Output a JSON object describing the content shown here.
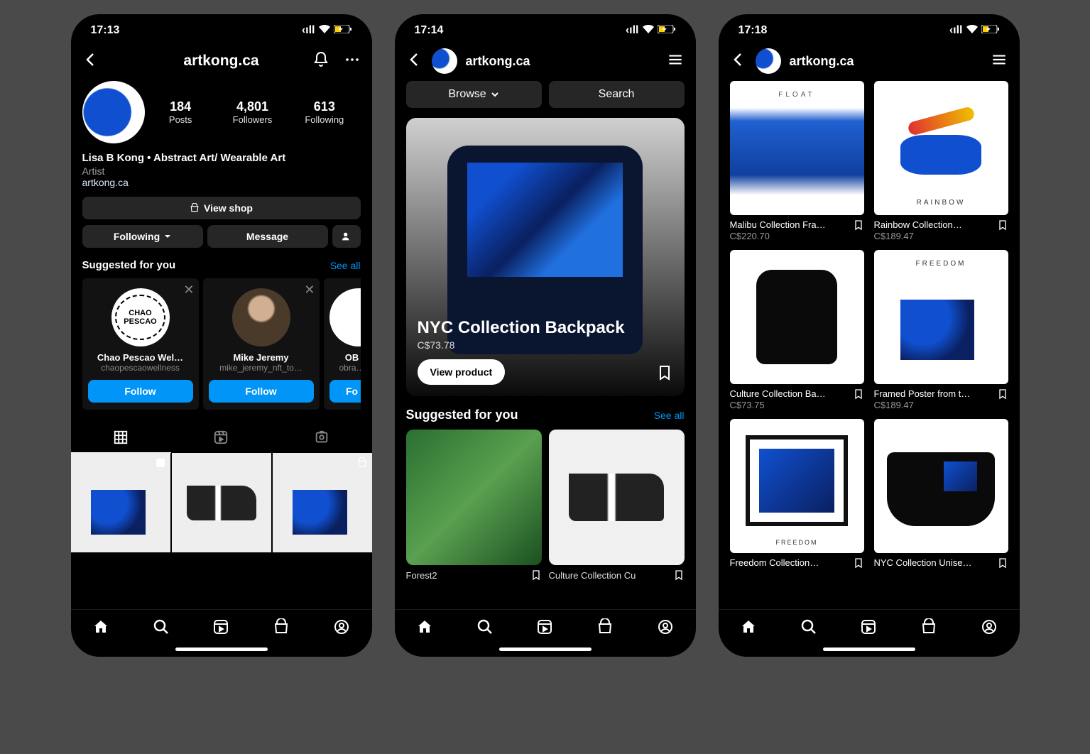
{
  "phone1": {
    "status_time": "17:13",
    "header_title": "artkong.ca",
    "stats": {
      "posts": "184",
      "posts_lbl": "Posts",
      "followers": "4,801",
      "followers_lbl": "Followers",
      "following": "613",
      "following_lbl": "Following"
    },
    "bio_name": "Lisa B Kong • Abstract Art/ Wearable Art",
    "bio_category": "Artist",
    "bio_link": "artkong.ca",
    "view_shop": "View shop",
    "following_btn": "Following",
    "message_btn": "Message",
    "suggested_title": "Suggested for you",
    "see_all": "See all",
    "suggestions": [
      {
        "name": "Chao Pescao Wel…",
        "handle": "chaopescaowellness",
        "follow": "Follow"
      },
      {
        "name": "Mike Jeremy",
        "handle": "mike_jeremy_nft_to…",
        "follow": "Follow"
      },
      {
        "name": "OB",
        "handle": "obra…",
        "follow": "Fo"
      }
    ]
  },
  "phone2": {
    "status_time": "17:14",
    "header_title": "artkong.ca",
    "browse": "Browse",
    "search": "Search",
    "hero_title": "NYC Collection Backpack",
    "hero_price": "C$73.78",
    "view_product": "View product",
    "suggested_title": "Suggested for you",
    "see_all": "See all",
    "products": [
      {
        "name": "Forest2"
      },
      {
        "name": "Culture Collection Cu"
      }
    ]
  },
  "phone3": {
    "status_time": "17:18",
    "header_title": "artkong.ca",
    "products": [
      {
        "name": "Malibu Collection Fra…",
        "price": "C$220.70",
        "art_label": "FLOAT"
      },
      {
        "name": "Rainbow Collection…",
        "price": "C$189.47",
        "art_label": "RAINBOW"
      },
      {
        "name": "Culture Collection Ba…",
        "price": "C$73.75"
      },
      {
        "name": "Framed Poster from t…",
        "price": "C$189.47",
        "art_label": "FREEDOM"
      },
      {
        "name": "Freedom Collection…",
        "price": "",
        "art_label": "FREEDOM"
      },
      {
        "name": "NYC Collection Unise…",
        "price": ""
      }
    ]
  }
}
